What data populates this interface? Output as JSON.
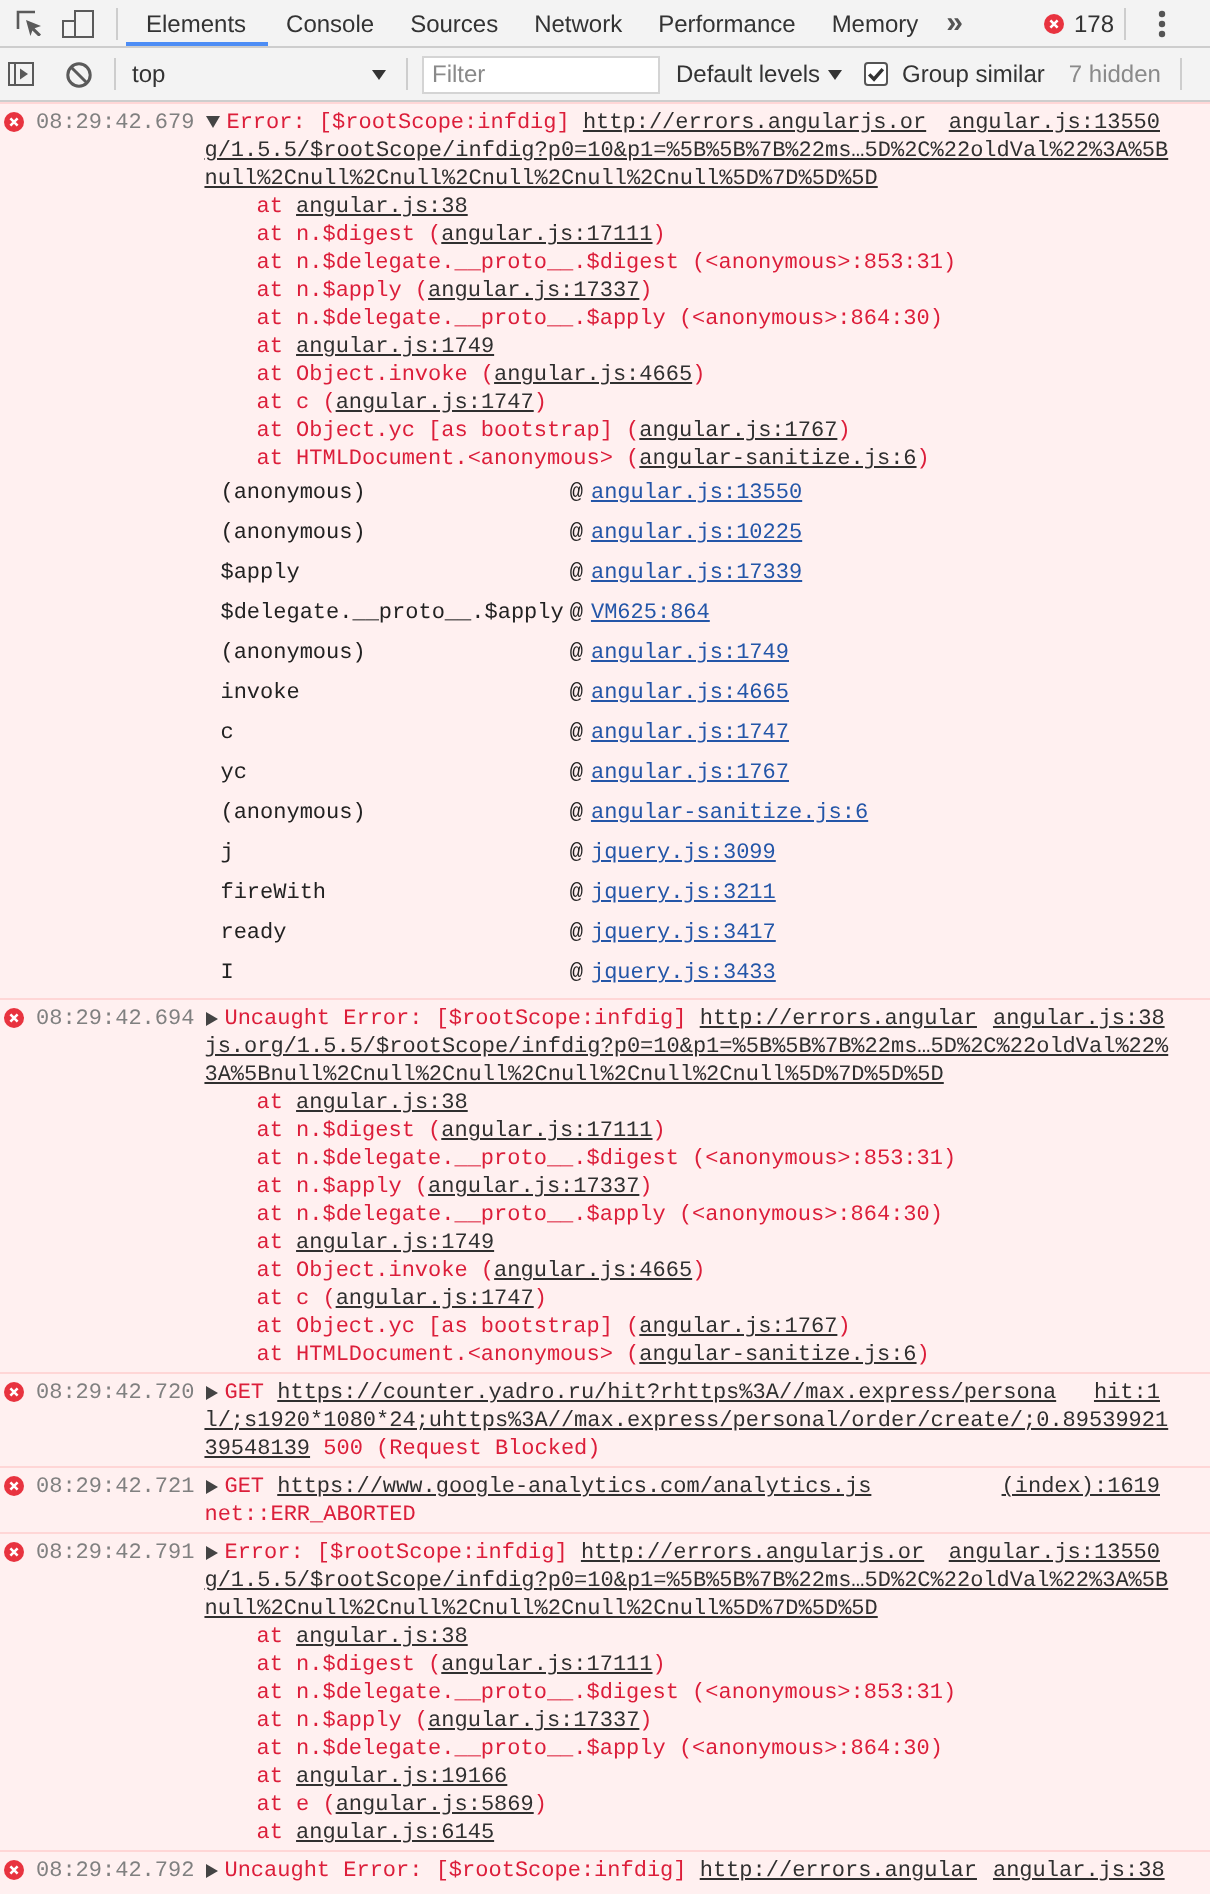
{
  "toolbar": {
    "tabs": [
      {
        "label": "Elements",
        "selected": true
      },
      {
        "label": "Console",
        "selected": false
      },
      {
        "label": "Sources",
        "selected": false
      },
      {
        "label": "Network",
        "selected": false
      },
      {
        "label": "Performance",
        "selected": false
      },
      {
        "label": "Memory",
        "selected": false
      }
    ],
    "more_tabs": "»",
    "error_count": "178"
  },
  "console_toolbar": {
    "context": "top",
    "filter": {
      "placeholder": "Filter"
    },
    "levels": "Default levels",
    "group_similar": {
      "label": "Group similar",
      "checked": true
    },
    "hidden_count": "7 hidden"
  },
  "messages": [
    {
      "kind": "error",
      "time": "08:29:42.679",
      "expanded": true,
      "source": "angular.js:13550",
      "lines": [
        [
          {
            "kind": "text",
            "text": "Error: [$rootScope:infdig] "
          },
          {
            "kind": "link",
            "text": "http://errors.angularjs.or"
          }
        ],
        [
          {
            "kind": "link",
            "text": "g/1.5.5/$rootScope/infdig?p0=10&p1=%5B%5B%7B%22ms…5D%2C%22oldVal%22%3A%5B"
          }
        ],
        [
          {
            "kind": "link",
            "text": "null%2Cnull%2Cnull%2Cnull%2Cnull%2Cnull%5D%7D%5D%5D"
          }
        ]
      ],
      "stack": [
        [
          {
            "kind": "text",
            "text": "at "
          },
          {
            "kind": "link",
            "text": "angular.js:38"
          }
        ],
        [
          {
            "kind": "text",
            "text": "at n.$digest ("
          },
          {
            "kind": "link",
            "text": "angular.js:17111"
          },
          {
            "kind": "text",
            "text": ")"
          }
        ],
        [
          {
            "kind": "text",
            "text": "at n.$delegate.__proto__.$digest (<anonymous>:853:31)"
          }
        ],
        [
          {
            "kind": "text",
            "text": "at n.$apply ("
          },
          {
            "kind": "link",
            "text": "angular.js:17337"
          },
          {
            "kind": "text",
            "text": ")"
          }
        ],
        [
          {
            "kind": "text",
            "text": "at n.$delegate.__proto__.$apply (<anonymous>:864:30)"
          }
        ],
        [
          {
            "kind": "text",
            "text": "at "
          },
          {
            "kind": "link",
            "text": "angular.js:1749"
          }
        ],
        [
          {
            "kind": "text",
            "text": "at Object.invoke ("
          },
          {
            "kind": "link",
            "text": "angular.js:4665"
          },
          {
            "kind": "text",
            "text": ")"
          }
        ],
        [
          {
            "kind": "text",
            "text": "at c ("
          },
          {
            "kind": "link",
            "text": "angular.js:1747"
          },
          {
            "kind": "text",
            "text": ")"
          }
        ],
        [
          {
            "kind": "text",
            "text": "at Object.yc [as bootstrap] ("
          },
          {
            "kind": "link",
            "text": "angular.js:1767"
          },
          {
            "kind": "text",
            "text": ")"
          }
        ],
        [
          {
            "kind": "text",
            "text": "at HTMLDocument.<anonymous> ("
          },
          {
            "kind": "link",
            "text": "angular-sanitize.js:6"
          },
          {
            "kind": "text",
            "text": ")"
          }
        ]
      ],
      "call_stack": [
        {
          "function": "(anonymous)",
          "separator": "@",
          "location": "angular.js:13550"
        },
        {
          "function": "(anonymous)",
          "separator": "@",
          "location": "angular.js:10225"
        },
        {
          "function": "$apply",
          "separator": "@",
          "location": "angular.js:17339"
        },
        {
          "function": "$delegate.__proto__.$apply",
          "separator": "@",
          "location": "VM625:864"
        },
        {
          "function": "(anonymous)",
          "separator": "@",
          "location": "angular.js:1749"
        },
        {
          "function": "invoke",
          "separator": "@",
          "location": "angular.js:4665"
        },
        {
          "function": "c",
          "separator": "@",
          "location": "angular.js:1747"
        },
        {
          "function": "yc",
          "separator": "@",
          "location": "angular.js:1767"
        },
        {
          "function": "(anonymous)",
          "separator": "@",
          "location": "angular-sanitize.js:6"
        },
        {
          "function": "j",
          "separator": "@",
          "location": "jquery.js:3099"
        },
        {
          "function": "fireWith",
          "separator": "@",
          "location": "jquery.js:3211"
        },
        {
          "function": "ready",
          "separator": "@",
          "location": "jquery.js:3417"
        },
        {
          "function": "I",
          "separator": "@",
          "location": "jquery.js:3433"
        }
      ]
    },
    {
      "kind": "error",
      "time": "08:29:42.694",
      "expanded": false,
      "source": "angular.js:38",
      "lines": [
        [
          {
            "kind": "text",
            "text": "Uncaught Error: [$rootScope:infdig] "
          },
          {
            "kind": "link",
            "text": "http://errors.angular"
          }
        ],
        [
          {
            "kind": "link",
            "text": "js.org/1.5.5/$rootScope/infdig?p0=10&p1=%5B%5B%7B%22ms…5D%2C%22oldVal%22%"
          }
        ],
        [
          {
            "kind": "link",
            "text": "3A%5Bnull%2Cnull%2Cnull%2Cnull%2Cnull%2Cnull%5D%7D%5D%5D"
          }
        ]
      ],
      "stack": [
        [
          {
            "kind": "text",
            "text": "at "
          },
          {
            "kind": "link",
            "text": "angular.js:38"
          }
        ],
        [
          {
            "kind": "text",
            "text": "at n.$digest ("
          },
          {
            "kind": "link",
            "text": "angular.js:17111"
          },
          {
            "kind": "text",
            "text": ")"
          }
        ],
        [
          {
            "kind": "text",
            "text": "at n.$delegate.__proto__.$digest (<anonymous>:853:31)"
          }
        ],
        [
          {
            "kind": "text",
            "text": "at n.$apply ("
          },
          {
            "kind": "link",
            "text": "angular.js:17337"
          },
          {
            "kind": "text",
            "text": ")"
          }
        ],
        [
          {
            "kind": "text",
            "text": "at n.$delegate.__proto__.$apply (<anonymous>:864:30)"
          }
        ],
        [
          {
            "kind": "text",
            "text": "at "
          },
          {
            "kind": "link",
            "text": "angular.js:1749"
          }
        ],
        [
          {
            "kind": "text",
            "text": "at Object.invoke ("
          },
          {
            "kind": "link",
            "text": "angular.js:4665"
          },
          {
            "kind": "text",
            "text": ")"
          }
        ],
        [
          {
            "kind": "text",
            "text": "at c ("
          },
          {
            "kind": "link",
            "text": "angular.js:1747"
          },
          {
            "kind": "text",
            "text": ")"
          }
        ],
        [
          {
            "kind": "text",
            "text": "at Object.yc [as bootstrap] ("
          },
          {
            "kind": "link",
            "text": "angular.js:1767"
          },
          {
            "kind": "text",
            "text": ")"
          }
        ],
        [
          {
            "kind": "text",
            "text": "at HTMLDocument.<anonymous> ("
          },
          {
            "kind": "link",
            "text": "angular-sanitize.js:6"
          },
          {
            "kind": "text",
            "text": ")"
          }
        ]
      ]
    },
    {
      "kind": "error",
      "time": "08:29:42.720",
      "expanded": false,
      "source": "hit:1",
      "lines": [
        [
          {
            "kind": "text",
            "text": "GET "
          },
          {
            "kind": "link",
            "text": "https://counter.yadro.ru/hit?rhttps%3A//max.express/persona"
          }
        ],
        [
          {
            "kind": "link",
            "text": "l/;s1920*1080*24;uhttps%3A//max.express/personal/order/create/;0.89539921"
          }
        ],
        [
          {
            "kind": "link",
            "text": "39548139"
          },
          {
            "kind": "text",
            "text": " 500 (Request Blocked)"
          }
        ]
      ]
    },
    {
      "kind": "error",
      "time": "08:29:42.721",
      "expanded": false,
      "source": "(index):1619",
      "lines": [
        [
          {
            "kind": "text",
            "text": "GET "
          },
          {
            "kind": "link",
            "text": "https://www.google-analytics.com/analytics.js"
          }
        ],
        [
          {
            "kind": "text",
            "text": "net::ERR_ABORTED"
          }
        ]
      ]
    },
    {
      "kind": "error",
      "time": "08:29:42.791",
      "expanded": false,
      "source": "angular.js:13550",
      "lines": [
        [
          {
            "kind": "text",
            "text": "Error: [$rootScope:infdig] "
          },
          {
            "kind": "link",
            "text": "http://errors.angularjs.or"
          }
        ],
        [
          {
            "kind": "link",
            "text": "g/1.5.5/$rootScope/infdig?p0=10&p1=%5B%5B%7B%22ms…5D%2C%22oldVal%22%3A%5B"
          }
        ],
        [
          {
            "kind": "link",
            "text": "null%2Cnull%2Cnull%2Cnull%2Cnull%2Cnull%5D%7D%5D%5D"
          }
        ]
      ],
      "stack": [
        [
          {
            "kind": "text",
            "text": "at "
          },
          {
            "kind": "link",
            "text": "angular.js:38"
          }
        ],
        [
          {
            "kind": "text",
            "text": "at n.$digest ("
          },
          {
            "kind": "link",
            "text": "angular.js:17111"
          },
          {
            "kind": "text",
            "text": ")"
          }
        ],
        [
          {
            "kind": "text",
            "text": "at n.$delegate.__proto__.$digest (<anonymous>:853:31)"
          }
        ],
        [
          {
            "kind": "text",
            "text": "at n.$apply ("
          },
          {
            "kind": "link",
            "text": "angular.js:17337"
          },
          {
            "kind": "text",
            "text": ")"
          }
        ],
        [
          {
            "kind": "text",
            "text": "at n.$delegate.__proto__.$apply (<anonymous>:864:30)"
          }
        ],
        [
          {
            "kind": "text",
            "text": "at "
          },
          {
            "kind": "link",
            "text": "angular.js:19166"
          }
        ],
        [
          {
            "kind": "text",
            "text": "at e ("
          },
          {
            "kind": "link",
            "text": "angular.js:5869"
          },
          {
            "kind": "text",
            "text": ")"
          }
        ],
        [
          {
            "kind": "text",
            "text": "at "
          },
          {
            "kind": "link",
            "text": "angular.js:6145"
          }
        ]
      ]
    },
    {
      "kind": "error",
      "time": "08:29:42.792",
      "expanded": false,
      "source": "angular.js:38",
      "lines": [
        [
          {
            "kind": "text",
            "text": "Uncaught Error: [$rootScope:infdig] "
          },
          {
            "kind": "link",
            "text": "http://errors.angular"
          }
        ]
      ]
    }
  ]
}
